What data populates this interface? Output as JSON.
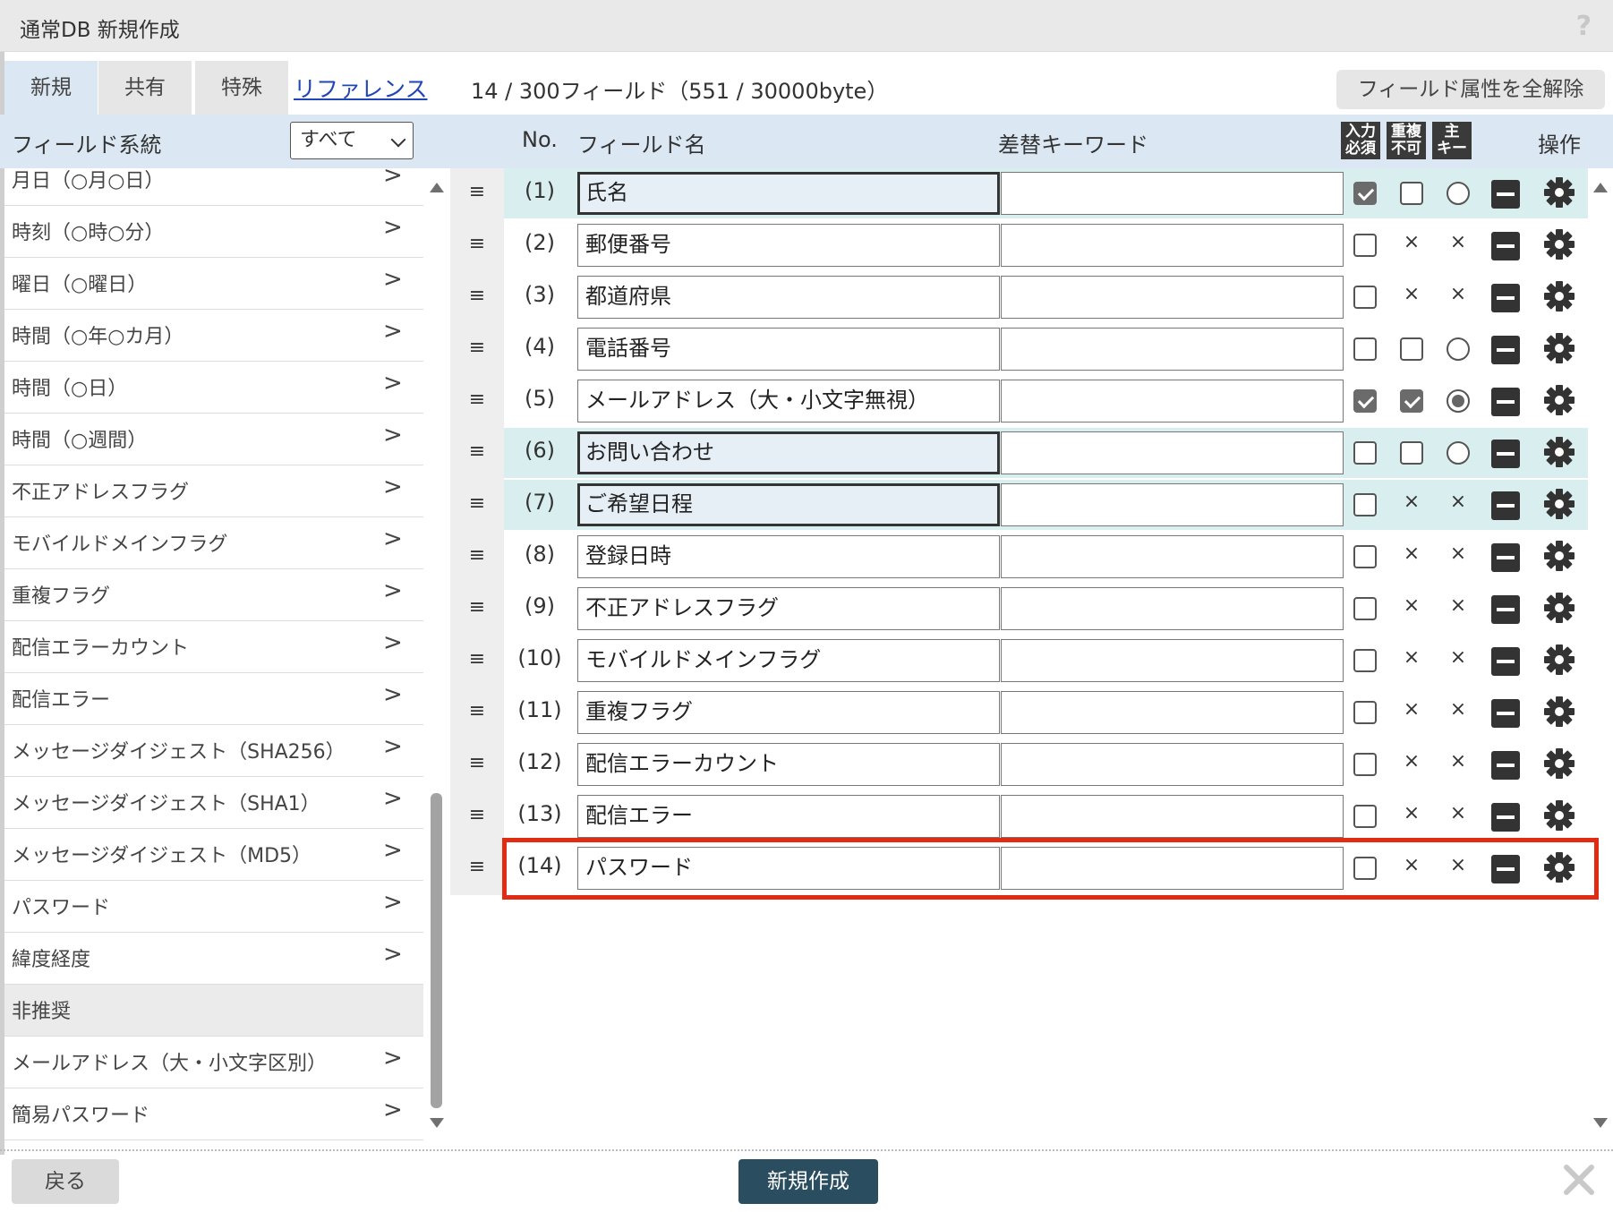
{
  "window": {
    "title": "通常DB 新規作成",
    "help": "?"
  },
  "tabs": [
    {
      "label": "新規",
      "active": true
    },
    {
      "label": "共有",
      "active": false
    },
    {
      "label": "特殊",
      "active": false
    }
  ],
  "reference_link": "リファレンス",
  "field_count": "14 / 300フィールド（551 / 30000byte）",
  "clear_button": "フィールド属性を全解除",
  "left_panel": {
    "header": "フィールド系統",
    "filter_value": "すべて",
    "items": [
      {
        "label": "月日（○月○日）",
        "arrow": ">"
      },
      {
        "label": "時刻（○時○分）",
        "arrow": ">"
      },
      {
        "label": "曜日（○曜日）",
        "arrow": ">"
      },
      {
        "label": "時間（○年○カ月）",
        "arrow": ">"
      },
      {
        "label": "時間（○日）",
        "arrow": ">"
      },
      {
        "label": "時間（○週間）",
        "arrow": ">"
      },
      {
        "label": "不正アドレスフラグ",
        "arrow": ">"
      },
      {
        "label": "モバイルドメインフラグ",
        "arrow": ">"
      },
      {
        "label": "重複フラグ",
        "arrow": ">"
      },
      {
        "label": "配信エラーカウント",
        "arrow": ">"
      },
      {
        "label": "配信エラー",
        "arrow": ">"
      },
      {
        "label": "メッセージダイジェスト（SHA256）",
        "arrow": ">"
      },
      {
        "label": "メッセージダイジェスト（SHA1）",
        "arrow": ">"
      },
      {
        "label": "メッセージダイジェスト（MD5）",
        "arrow": ">"
      },
      {
        "label": "パスワード",
        "arrow": ">"
      },
      {
        "label": "緯度経度",
        "arrow": ">"
      },
      {
        "label": "非推奨",
        "arrow": "",
        "section": true
      },
      {
        "label": "メールアドレス（大・小文字区別）",
        "arrow": ">"
      },
      {
        "label": "簡易パスワード",
        "arrow": ">"
      }
    ]
  },
  "columns": {
    "no": "No.",
    "field_name": "フィールド名",
    "keyword": "差替キーワード",
    "required_icon": [
      "入力",
      "必須"
    ],
    "unique_icon": [
      "重複",
      "不可"
    ],
    "primary_icon": [
      "主",
      "キー"
    ],
    "operations": "操作"
  },
  "fields": [
    {
      "no": "(1)",
      "name": "氏名",
      "keyword": "",
      "highlight": true,
      "active": true,
      "required": "checked",
      "unique": "unchecked",
      "primary": "radio"
    },
    {
      "no": "(2)",
      "name": "郵便番号",
      "keyword": "",
      "highlight": false,
      "active": false,
      "required": "unchecked",
      "unique": "x",
      "primary": "x"
    },
    {
      "no": "(3)",
      "name": "都道府県",
      "keyword": "",
      "highlight": false,
      "active": false,
      "required": "unchecked",
      "unique": "x",
      "primary": "x"
    },
    {
      "no": "(4)",
      "name": "電話番号",
      "keyword": "",
      "highlight": false,
      "active": false,
      "required": "unchecked",
      "unique": "unchecked",
      "primary": "radio"
    },
    {
      "no": "(5)",
      "name": "メールアドレス（大・小文字無視）",
      "keyword": "",
      "highlight": false,
      "active": false,
      "required": "checked",
      "unique": "checked",
      "primary": "radio-checked"
    },
    {
      "no": "(6)",
      "name": "お問い合わせ",
      "keyword": "",
      "highlight": true,
      "active": true,
      "required": "unchecked",
      "unique": "unchecked",
      "primary": "radio"
    },
    {
      "no": "(7)",
      "name": "ご希望日程",
      "keyword": "",
      "highlight": true,
      "active": true,
      "required": "unchecked",
      "unique": "x",
      "primary": "x"
    },
    {
      "no": "(8)",
      "name": "登録日時",
      "keyword": "",
      "highlight": false,
      "active": false,
      "required": "unchecked",
      "unique": "x",
      "primary": "x"
    },
    {
      "no": "(9)",
      "name": "不正アドレスフラグ",
      "keyword": "",
      "highlight": false,
      "active": false,
      "required": "unchecked",
      "unique": "x",
      "primary": "x"
    },
    {
      "no": "(10)",
      "name": "モバイルドメインフラグ",
      "keyword": "",
      "highlight": false,
      "active": false,
      "required": "unchecked",
      "unique": "x",
      "primary": "x"
    },
    {
      "no": "(11)",
      "name": "重複フラグ",
      "keyword": "",
      "highlight": false,
      "active": false,
      "required": "unchecked",
      "unique": "x",
      "primary": "x"
    },
    {
      "no": "(12)",
      "name": "配信エラーカウント",
      "keyword": "",
      "highlight": false,
      "active": false,
      "required": "unchecked",
      "unique": "x",
      "primary": "x"
    },
    {
      "no": "(13)",
      "name": "配信エラー",
      "keyword": "",
      "highlight": false,
      "active": false,
      "required": "unchecked",
      "unique": "x",
      "primary": "x"
    },
    {
      "no": "(14)",
      "name": "パスワード",
      "keyword": "",
      "highlight": false,
      "active": false,
      "required": "unchecked",
      "unique": "x",
      "primary": "x"
    }
  ],
  "symbols": {
    "drag_handle": "≡",
    "x_mark": "×"
  },
  "footer": {
    "back": "戻る",
    "create": "新規作成"
  },
  "colors": {
    "accent_header": "#dbe8f3",
    "row_highlight": "#d9efef",
    "emphasis_box": "#e22b13",
    "primary_button": "#2a4d60"
  }
}
